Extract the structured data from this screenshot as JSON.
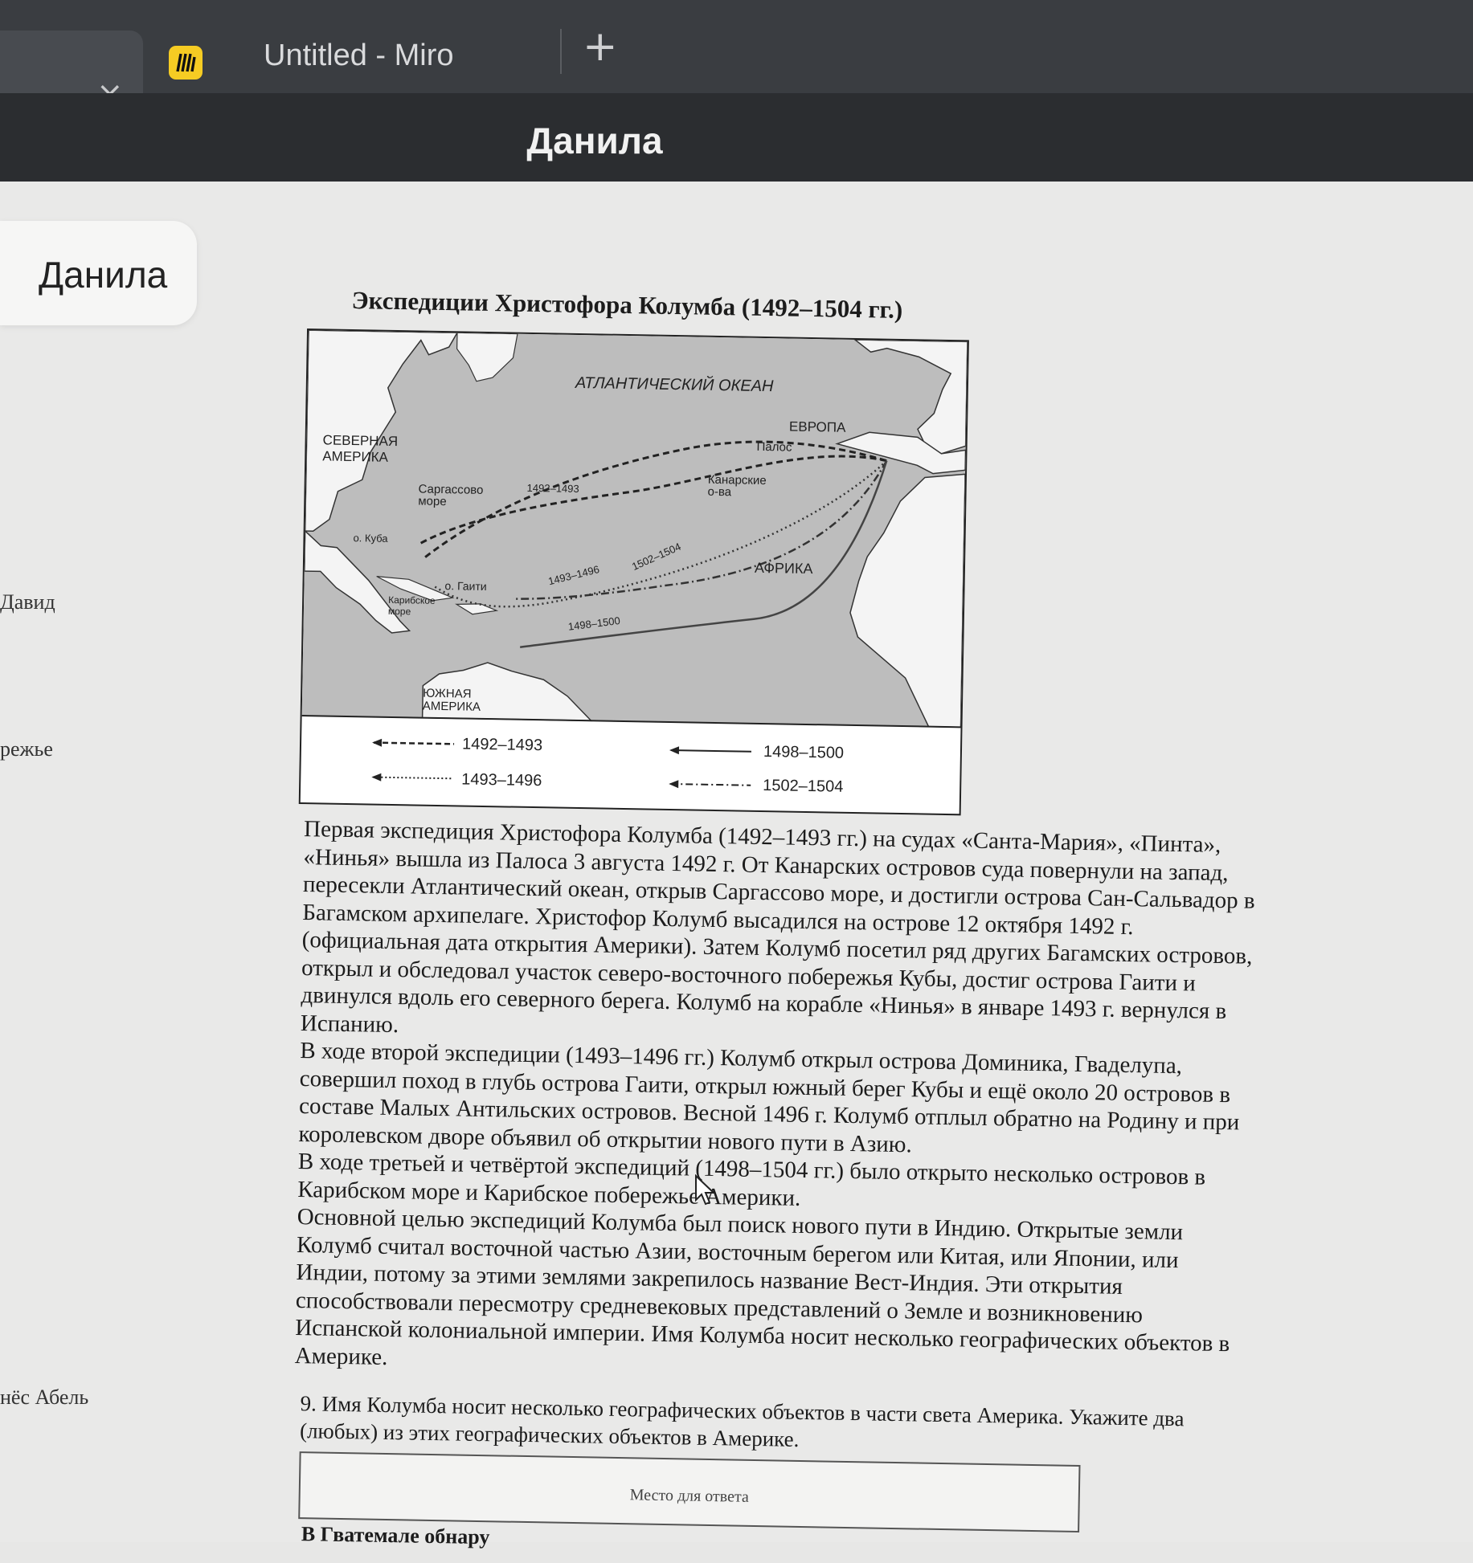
{
  "browser": {
    "prev_tab_close": "×",
    "tab_title": "Untitled - Miro",
    "new_tab": "+",
    "header_title": "Данила"
  },
  "sidebar": {
    "card_name": "Данила",
    "names": [
      "Давид",
      "режье",
      "нёс Абель"
    ]
  },
  "document": {
    "title": "Экспедиции Христофора Колумба (1492–1504 гг.)",
    "map": {
      "labels": {
        "ocean": "АТЛАНТИЧЕСКИЙ ОКЕАН",
        "europe": "ЕВРОПА",
        "north_america_1": "СЕВЕРНАЯ",
        "north_america_2": "АМЕРИКА",
        "palos": "Палос",
        "canary_1": "Канарские",
        "canary_2": "о-ва",
        "sargasso_1": "Саргассово",
        "sargasso_2": "море",
        "route_1492": "1492–1493",
        "cuba": "о. Куба",
        "haiti": "о. Гаити",
        "caribbean_1": "Карибское",
        "caribbean_2": "море",
        "route_1493": "1493–1496",
        "route_1502": "1502–1504",
        "africa": "АФРИКА",
        "route_1498": "1498–1500",
        "south_america_1": "ЮЖНАЯ",
        "south_america_2": "АМЕРИКА"
      },
      "legend": {
        "l1": "1492–1493",
        "l2": "1498–1500",
        "l3": "1493–1496",
        "l4": "1502–1504"
      }
    },
    "paragraphs": [
      "Первая экспедиция Христофора Колумба (1492–1493 гг.) на судах «Санта-Мария», «Пинта», «Нинья» вышла из Палоса 3 августа 1492 г. От Канарских островов суда повернули на запад, пересекли Атлантический океан, открыв Саргассово море, и достигли острова Сан-Сальвадор в Багамском архипелаге. Христофор Колумб высадился на острове 12 октября 1492 г. (официальная дата открытия Америки). Затем Колумб посетил ряд других Багамских островов, открыл и обследовал участок северо-восточного побережья Кубы, достиг острова Гаити и двинулся вдоль его северного берега. Колумб на корабле «Нинья» в январе 1493 г. вернулся в Испанию.",
      "В ходе второй экспедиции (1493–1496 гг.) Колумб открыл острова Доминика, Гваделупа, совершил поход в глубь острова Гаити, открыл южный берег Кубы и ещё около 20 островов в составе Малых Антильских островов. Весной 1496 г. Колумб отплыл обратно на Родину и при королевском дворе объявил об открытии нового пути в Азию.",
      "В ходе третьей и четвёртой экспедиций (1498–1504 гг.) было открыто несколько островов в Карибском море и Карибское побережье Америки.",
      "Основной целью экспедиций Колумба был поиск нового пути в Индию. Открытые земли Колумб считал восточной частью Азии, восточным берегом или Китая, или Японии, или Индии, потому за этими землями закрепилось название Вест-Индия. Эти открытия способствовали пересмотру средневековых представлений о Земле и возникновению Испанской колониальной империи. Имя Колумба носит несколько географических объектов в Америке."
    ],
    "question": "9. Имя Колумба носит несколько географических объектов в части света Америка. Укажите два (любых) из этих географических объектов в Америке.",
    "answer_placeholder": "Место для ответа",
    "next_text": "В Гватемале обнару"
  }
}
